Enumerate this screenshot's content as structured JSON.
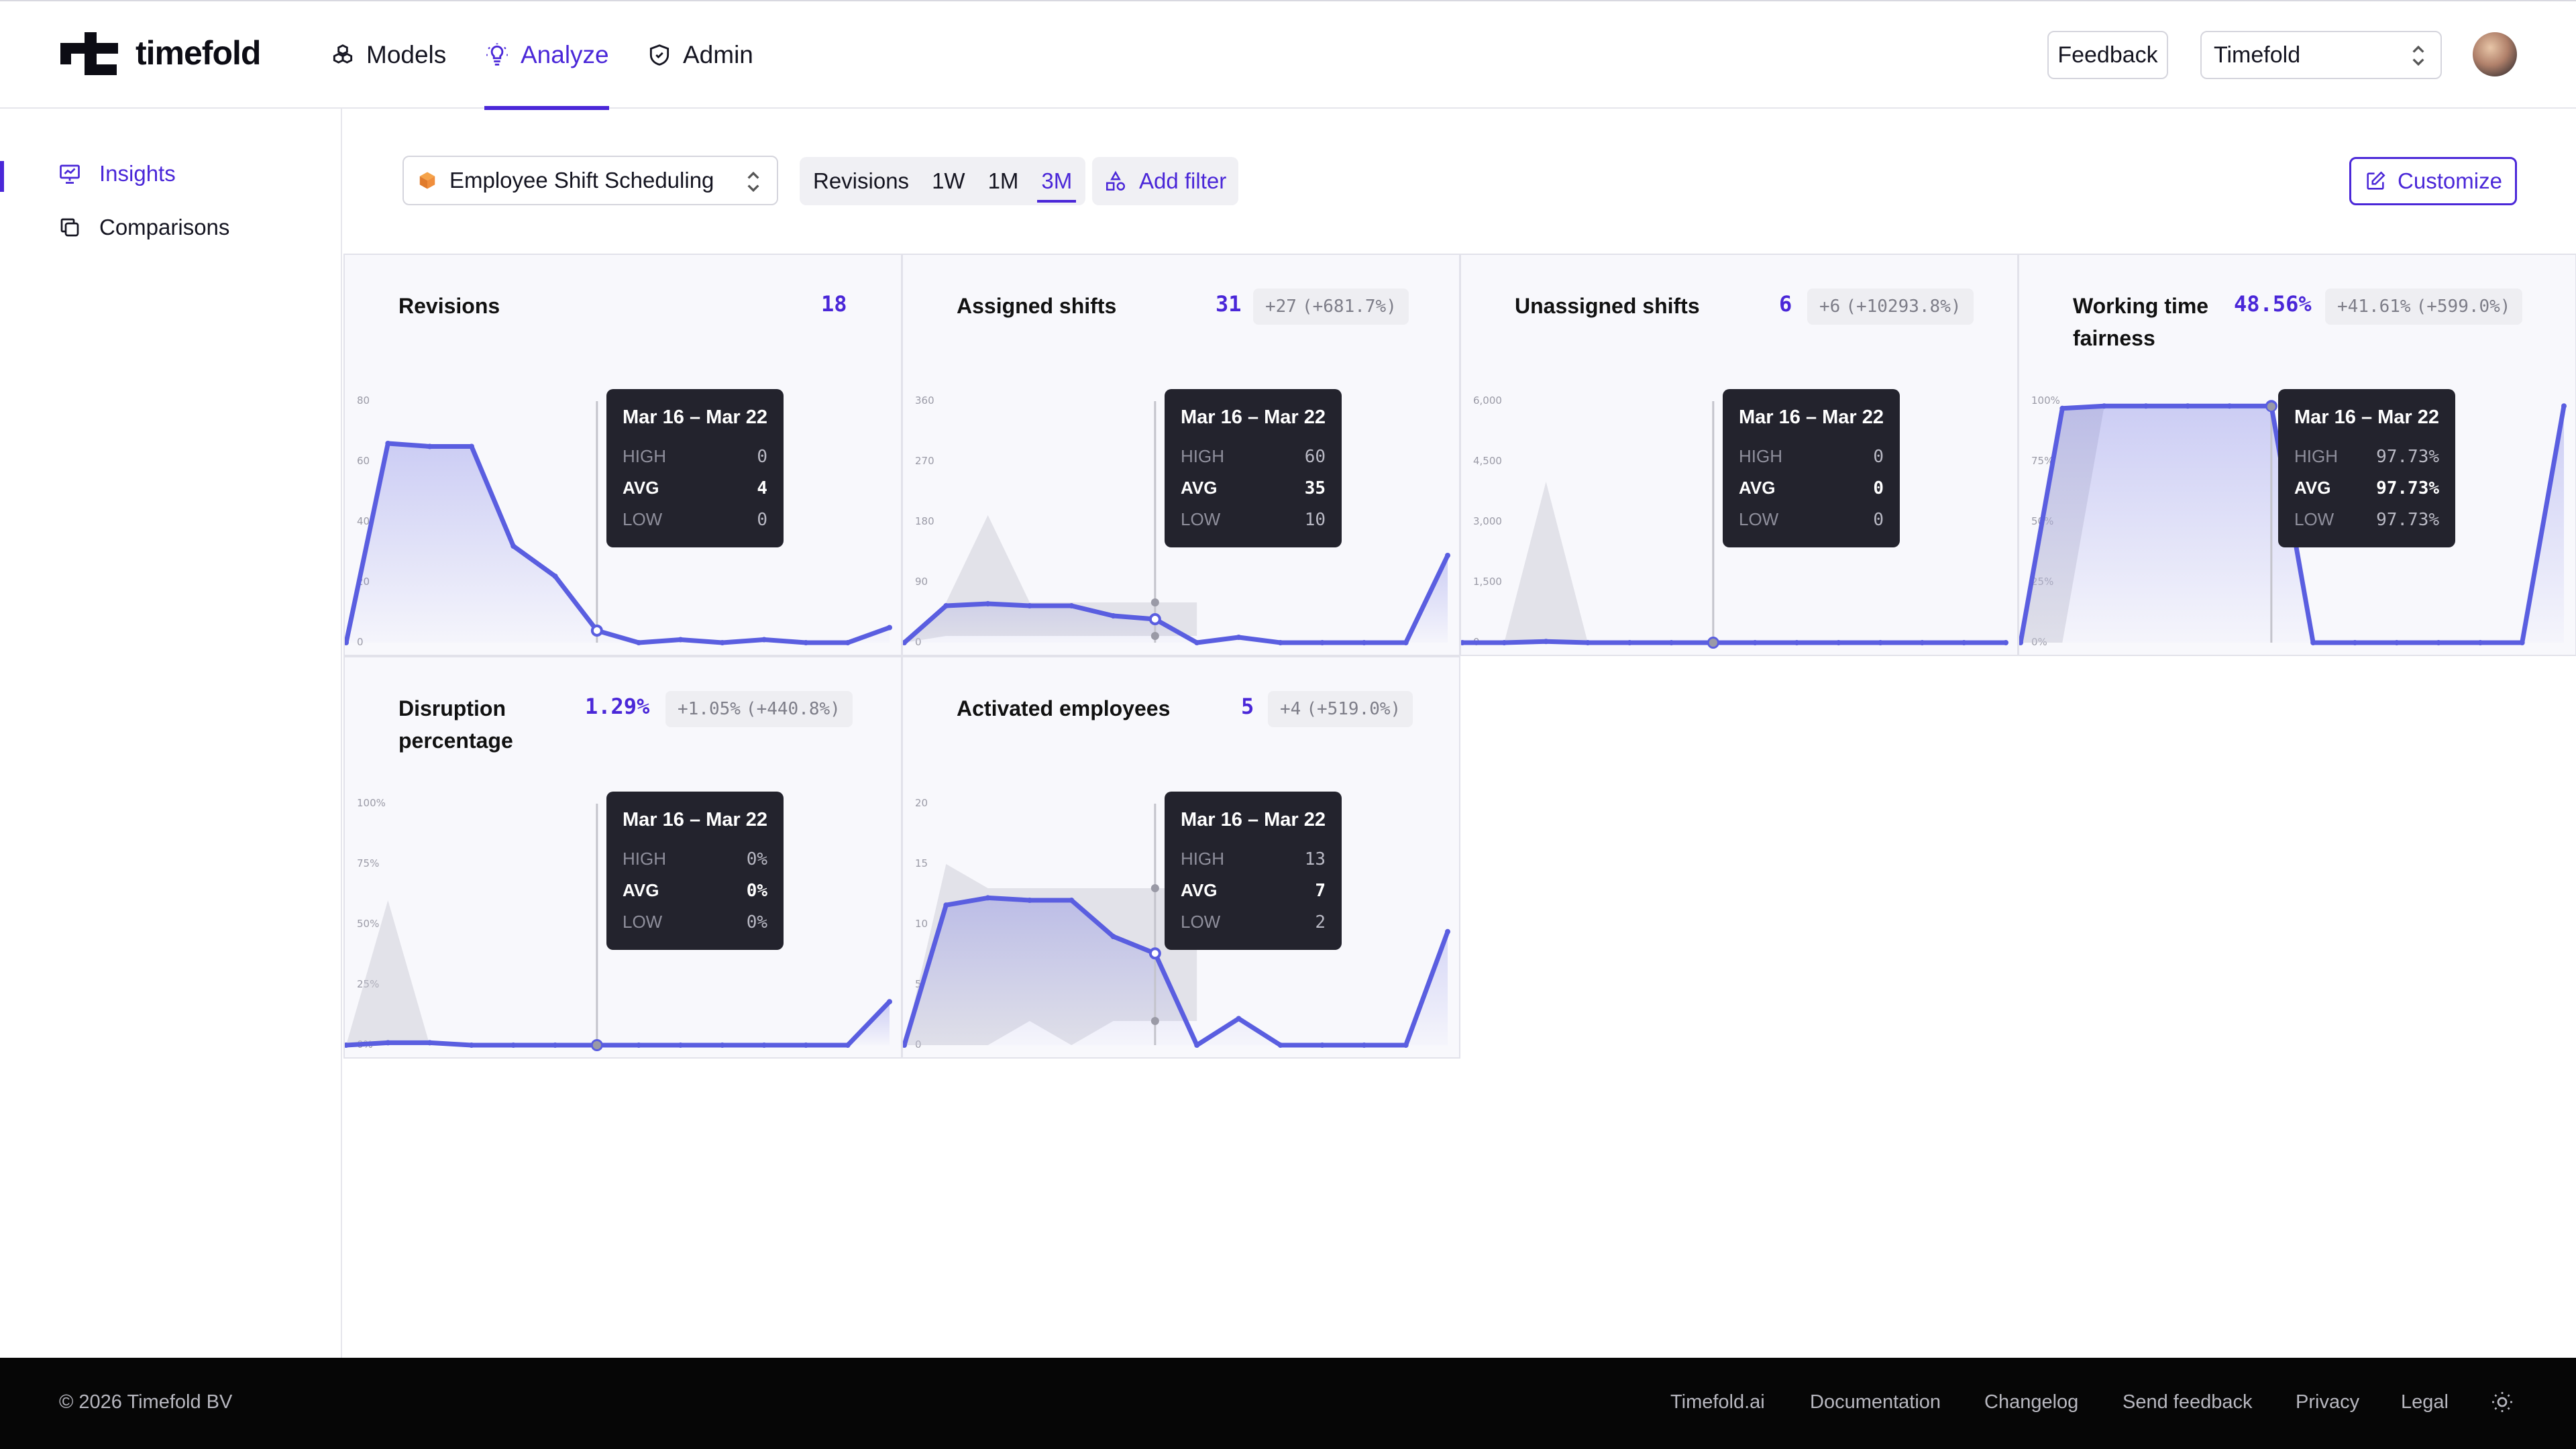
{
  "header": {
    "logo_text": "timefold",
    "nav": [
      {
        "label": "Models",
        "icon": "cube-stack-icon"
      },
      {
        "label": "Analyze",
        "icon": "lightbulb-icon",
        "active": true
      },
      {
        "label": "Admin",
        "icon": "shield-icon"
      }
    ],
    "feedback_label": "Feedback",
    "org_selected": "Timefold"
  },
  "sidebar": {
    "items": [
      {
        "label": "Insights",
        "icon": "presentation-chart-icon",
        "active": true
      },
      {
        "label": "Comparisons",
        "icon": "copy-icon"
      }
    ]
  },
  "toolbar": {
    "scenario": "Employee Shift Scheduling",
    "range_label": "Revisions",
    "ranges": [
      "1W",
      "1M",
      "3M"
    ],
    "active_range": "3M",
    "add_filter": "Add filter",
    "customize": "Customize"
  },
  "colors": {
    "accent": "#4a27d8",
    "line": "#5a5ee0",
    "tooltip_bg": "#23232d",
    "footer_bg": "#060606"
  },
  "cards": [
    {
      "title": "Revisions",
      "value": "18",
      "delta": "",
      "delta_pct": "",
      "tooltip": {
        "title": "Mar 16 – Mar 22",
        "high": "0",
        "avg": "4",
        "low": "0"
      },
      "labels": {
        "high": "HIGH",
        "avg": "AVG",
        "low": "LOW"
      }
    },
    {
      "title": "Assigned shifts",
      "value": "31",
      "delta": "+27",
      "delta_pct": "(+681.7%)",
      "tooltip": {
        "title": "Mar 16 – Mar 22",
        "high": "60",
        "avg": "35",
        "low": "10"
      },
      "labels": {
        "high": "HIGH",
        "avg": "AVG",
        "low": "LOW"
      }
    },
    {
      "title": "Unassigned shifts",
      "value": "6",
      "delta": "+6",
      "delta_pct": "(+10293.8%)",
      "tooltip": {
        "title": "Mar 16 – Mar 22",
        "high": "0",
        "avg": "0",
        "low": "0"
      },
      "labels": {
        "high": "HIGH",
        "avg": "AVG",
        "low": "LOW"
      }
    },
    {
      "title": "Working time fairness",
      "value": "48.56%",
      "delta": "+41.61%",
      "delta_pct": "(+599.0%)",
      "tooltip": {
        "title": "Mar 16 – Mar 22",
        "high": "97.73%",
        "avg": "97.73%",
        "low": "97.73%"
      },
      "labels": {
        "high": "HIGH",
        "avg": "AVG",
        "low": "LOW"
      }
    },
    {
      "title": "Disruption percentage",
      "value": "1.29%",
      "delta": "+1.05%",
      "delta_pct": "(+440.8%)",
      "tooltip": {
        "title": "Mar 16 – Mar 22",
        "high": "0%",
        "avg": "0%",
        "low": "0%"
      },
      "labels": {
        "high": "HIGH",
        "avg": "AVG",
        "low": "LOW"
      }
    },
    {
      "title": "Activated employees",
      "value": "5",
      "delta": "+4",
      "delta_pct": "(+519.0%)",
      "tooltip": {
        "title": "Mar 16 – Mar 22",
        "high": "13",
        "avg": "7",
        "low": "2"
      },
      "labels": {
        "high": "HIGH",
        "avg": "AVG",
        "low": "LOW"
      }
    }
  ],
  "chart_data": [
    {
      "type": "line",
      "title": "Revisions",
      "yticks": [
        "0",
        "20",
        "40",
        "60",
        "80"
      ],
      "ylim": [
        0,
        80
      ],
      "series": [
        {
          "values": [
            0,
            66,
            65,
            65,
            32,
            22,
            4,
            0,
            1,
            0,
            1,
            0,
            0,
            5
          ]
        }
      ]
    },
    {
      "type": "line",
      "title": "Assigned shifts",
      "yticks": [
        "0",
        "90",
        "180",
        "270",
        "360"
      ],
      "ylim": [
        0,
        360
      ],
      "band": {
        "high": [
          0,
          60,
          190,
          60,
          60,
          60,
          60,
          60
        ],
        "low": [
          0,
          10,
          10,
          10,
          10,
          10,
          10,
          10
        ]
      },
      "series": [
        {
          "values": [
            0,
            55,
            58,
            55,
            55,
            40,
            35,
            0,
            8,
            0,
            0,
            0,
            0,
            130
          ]
        }
      ]
    },
    {
      "type": "line",
      "title": "Unassigned shifts",
      "yticks": [
        "0",
        "1,500",
        "3,000",
        "4,500",
        "6,000"
      ],
      "ylim": [
        0,
        6000
      ],
      "band": {
        "high": [
          0,
          0,
          4000,
          0,
          0,
          0,
          0,
          0
        ],
        "low": [
          0,
          0,
          0,
          0,
          0,
          0,
          0,
          0
        ]
      },
      "series": [
        {
          "values": [
            0,
            0,
            30,
            0,
            0,
            0,
            0,
            0,
            0,
            0,
            0,
            0,
            0,
            0
          ]
        }
      ]
    },
    {
      "type": "line",
      "title": "Working time fairness",
      "yticks": [
        "0%",
        "25%",
        "50%",
        "75%",
        "100%"
      ],
      "ylim": [
        0,
        100
      ],
      "band": {
        "high": [
          0,
          97.73,
          97.73,
          97.73,
          97.73,
          97.73,
          97.73,
          97.73
        ],
        "low": [
          0,
          0,
          97.73,
          97.73,
          97.73,
          97.73,
          97.73,
          97.73
        ]
      },
      "series": [
        {
          "values": [
            0,
            97,
            98,
            98,
            98,
            98,
            98,
            0,
            0,
            0,
            0,
            0,
            0,
            98
          ]
        }
      ]
    },
    {
      "type": "line",
      "title": "Disruption percentage",
      "yticks": [
        "0%",
        "25%",
        "50%",
        "75%",
        "100%"
      ],
      "ylim": [
        0,
        100
      ],
      "band": {
        "high": [
          0,
          60,
          0,
          0,
          0,
          0,
          0,
          0
        ],
        "low": [
          0,
          0,
          0,
          0,
          0,
          0,
          0,
          0
        ]
      },
      "series": [
        {
          "values": [
            0,
            1,
            1,
            0,
            0,
            0,
            0,
            0,
            0,
            0,
            0,
            0,
            0,
            18
          ]
        }
      ]
    },
    {
      "type": "line",
      "title": "Activated employees",
      "yticks": [
        "0",
        "5",
        "10",
        "15",
        "20"
      ],
      "ylim": [
        0,
        20
      ],
      "band": {
        "high": [
          0,
          15,
          13,
          13,
          13,
          13,
          13,
          13
        ],
        "low": [
          0,
          0,
          0,
          2,
          0,
          2,
          2,
          2
        ]
      },
      "series": [
        {
          "values": [
            0,
            11.6,
            12.2,
            12,
            12,
            9,
            7.6,
            0,
            2.2,
            0,
            0,
            0,
            0,
            9.4
          ]
        }
      ]
    }
  ],
  "footer": {
    "copyright": "© 2026 Timefold BV",
    "links": [
      "Timefold.ai",
      "Documentation",
      "Changelog",
      "Send feedback",
      "Privacy",
      "Legal"
    ]
  }
}
